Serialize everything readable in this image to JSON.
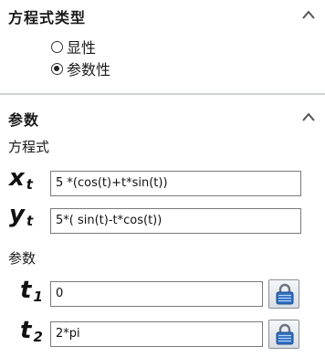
{
  "equation_type_section": {
    "title": "方程式类型",
    "options": [
      {
        "label": "显性",
        "checked": false
      },
      {
        "label": "参数性",
        "checked": true
      }
    ]
  },
  "params_section": {
    "title": "参数",
    "equation_label": "方程式",
    "x": {
      "var": "x",
      "sub": "t",
      "value": "5 *(cos(t)+t*sin(t))"
    },
    "y": {
      "var": "y",
      "sub": "t",
      "value": "5*( sin(t)-t*cos(t))"
    },
    "params_label": "参数",
    "t1": {
      "var": "t",
      "sub": "1",
      "value": "0"
    },
    "t2": {
      "var": "t",
      "sub": "2",
      "value": "2*pi"
    }
  },
  "icons": {
    "collapse": "chevron-up-icon",
    "lock": "lock-icon"
  }
}
